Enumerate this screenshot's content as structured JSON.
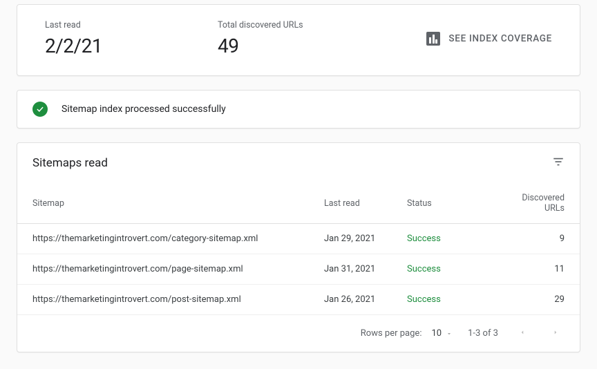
{
  "summary": {
    "last_read_label": "Last read",
    "last_read_value": "2/2/21",
    "total_label": "Total discovered URLs",
    "total_value": "49",
    "coverage_button": "SEE INDEX COVERAGE"
  },
  "status": {
    "message": "Sitemap index processed successfully"
  },
  "table": {
    "title": "Sitemaps read",
    "headers": {
      "sitemap": "Sitemap",
      "last_read": "Last read",
      "status": "Status",
      "discovered": "Discovered URLs"
    },
    "rows": [
      {
        "sitemap": "https://themarketingintrovert.com/category-sitemap.xml",
        "last_read": "Jan 29, 2021",
        "status": "Success",
        "discovered": "9"
      },
      {
        "sitemap": "https://themarketingintrovert.com/page-sitemap.xml",
        "last_read": "Jan 31, 2021",
        "status": "Success",
        "discovered": "11"
      },
      {
        "sitemap": "https://themarketingintrovert.com/post-sitemap.xml",
        "last_read": "Jan 26, 2021",
        "status": "Success",
        "discovered": "29"
      }
    ]
  },
  "pager": {
    "rows_per_page_label": "Rows per page:",
    "rows_per_page_value": "10",
    "range": "1-3 of 3"
  }
}
